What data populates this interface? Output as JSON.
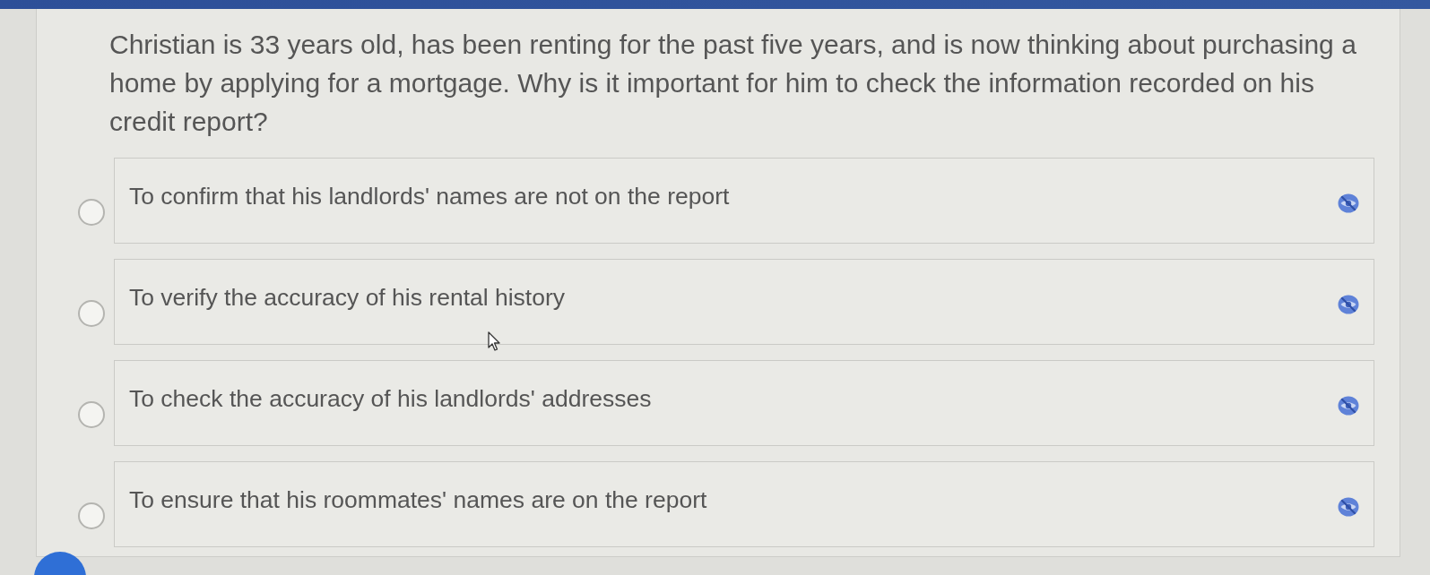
{
  "question": "Christian is 33 years old, has been renting for the past five years, and is now thinking about purchasing a home by applying for a mortgage. Why is it important for him to check the information recorded on his credit report?",
  "options": [
    {
      "text": "To confirm that his landlords' names are not on the report",
      "selected": false
    },
    {
      "text": "To verify the accuracy of his rental history",
      "selected": false
    },
    {
      "text": "To check the accuracy of his landlords' addresses",
      "selected": false
    },
    {
      "text": "To ensure that his roommates' names are on the report",
      "selected": false
    }
  ]
}
